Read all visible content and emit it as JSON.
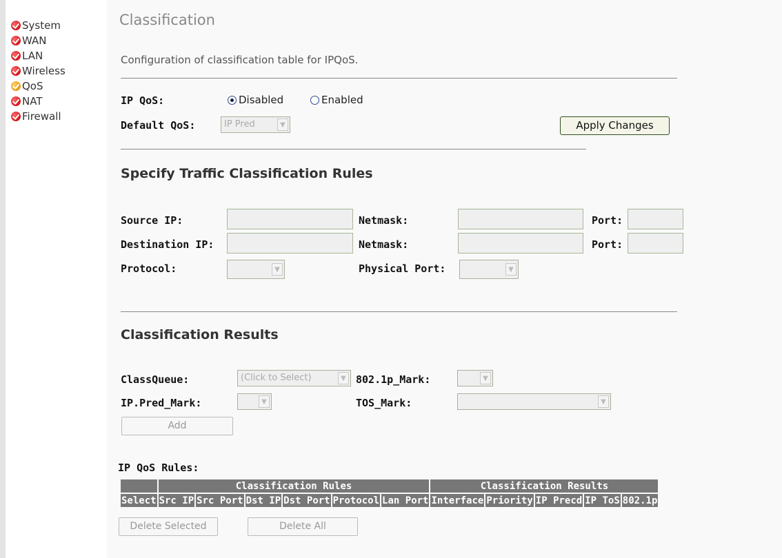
{
  "sidebar": {
    "items": [
      {
        "label": "System",
        "icon": "red-check-icon"
      },
      {
        "label": "WAN",
        "icon": "red-check-icon"
      },
      {
        "label": "LAN",
        "icon": "red-check-icon"
      },
      {
        "label": "Wireless",
        "icon": "red-check-icon"
      },
      {
        "label": "QoS",
        "icon": "orange-check-icon"
      },
      {
        "label": "NAT",
        "icon": "red-check-icon"
      },
      {
        "label": "Firewall",
        "icon": "red-check-icon"
      }
    ]
  },
  "page": {
    "title": "Classification",
    "description": "Configuration of classification table for IPQoS."
  },
  "qos": {
    "ip_qos_label": "IP QoS:",
    "disabled_label": "Disabled",
    "enabled_label": "Enabled",
    "selected": "Disabled",
    "default_qos_label": "Default QoS:",
    "default_qos_value": "IP Pred",
    "apply_label": "Apply Changes"
  },
  "traffic": {
    "heading": "Specify Traffic Classification Rules",
    "source_ip_label": "Source IP:",
    "destination_ip_label": "Destination IP:",
    "netmask_label": "Netmask:",
    "port_label": "Port:",
    "protocol_label": "Protocol:",
    "physical_port_label": "Physical Port:"
  },
  "results": {
    "heading": "Classification Results",
    "classqueue_label": "ClassQueue:",
    "classqueue_value": "(Click to Select)",
    "mark8021p_label": "802.1p_Mark:",
    "ippred_label": "IP.Pred_Mark:",
    "tos_label": "TOS_Mark:",
    "add_label": "Add"
  },
  "rules": {
    "title": "IP QoS Rules:",
    "group_rules": "Classification Rules",
    "group_results": "Classification Results",
    "columns": [
      "Select",
      "Src IP",
      "Src Port",
      "Dst IP",
      "Dst Port",
      "Protocol",
      "Lan Port",
      "Interface",
      "Priority",
      "IP Precd",
      "IP ToS",
      "802.1p"
    ]
  },
  "buttons": {
    "delete_selected": "Delete Selected",
    "delete_all": "Delete All"
  },
  "colors": {
    "table_header_bg": "#777777",
    "nav_icon_red": "#d0161c",
    "nav_icon_orange": "#e89a0c"
  }
}
